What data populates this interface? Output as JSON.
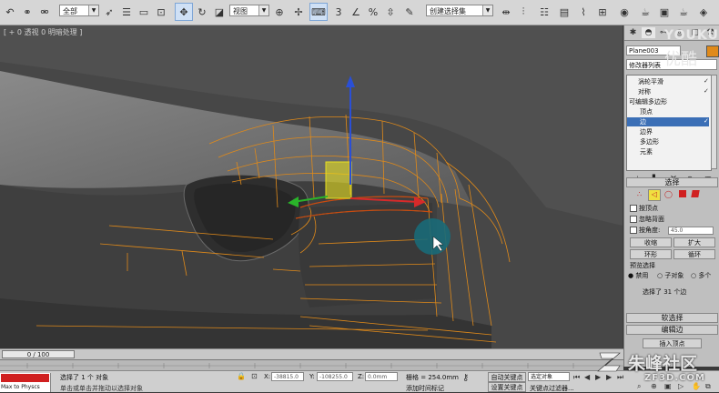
{
  "toolbar": {
    "selection_filter": "全部",
    "reference_coord": "视图",
    "named_selection": "创建选择集"
  },
  "viewport": {
    "label": "[ + 0 透视 0 明暗处理 ]"
  },
  "panel": {
    "object_name": "Plane003",
    "modifier_list": "修改器列表",
    "stack": [
      {
        "label": "涡轮平滑"
      },
      {
        "label": "对称"
      },
      {
        "label": "可编辑多边形"
      },
      {
        "label": "顶点"
      },
      {
        "label": "边"
      },
      {
        "label": "边界"
      },
      {
        "label": "多边形"
      },
      {
        "label": "元素"
      }
    ],
    "selection_header": "选择",
    "by_vertex": "按顶点",
    "ignore_backfacing": "忽略背面",
    "by_angle": "按角度:",
    "angle_value": "45.0",
    "shrink": "收缩",
    "grow": "扩大",
    "ring": "环形",
    "loop": "循环",
    "preview_selection": "预览选择",
    "disabled": "禁用",
    "subobject": "子对象",
    "multi": "多个",
    "selected_count": "选择了 31 个边",
    "soft_selection": "软选择",
    "edit_edges": "编辑边",
    "insert_vertex": "插入顶点"
  },
  "timeline": {
    "frame": "0 / 100"
  },
  "status": {
    "maxscript": "Max to Physcs",
    "selected": "选择了 1 个 对象",
    "prompt": "单击或单击并拖动以选择对象",
    "x_label": "X:",
    "x_value": "-38815.0",
    "y_label": "Y:",
    "y_value": "-108255.0",
    "z_label": "Z:",
    "z_value": "0.0mm",
    "grid": "栅格 = 254.0mm",
    "add_time_tag": "添加时间标记",
    "auto_key": "自动关键点",
    "set_key": "设置关键点",
    "selected_object": "选定对象",
    "key_filters": "关键点过滤器..."
  },
  "watermarks": {
    "youku_latin": "YOUKU",
    "youku_cn": "优酷",
    "zf3d_cn": "朱峰社区",
    "zf3d_url": "ZF3D.COM"
  },
  "colors": {
    "wire": "#e08a1a",
    "gizmo_z": "#2a4fd6",
    "gizmo_x": "#d62a2a",
    "gizmo_y": "#2ab42a",
    "selection_blue": "#3b6fb6"
  }
}
